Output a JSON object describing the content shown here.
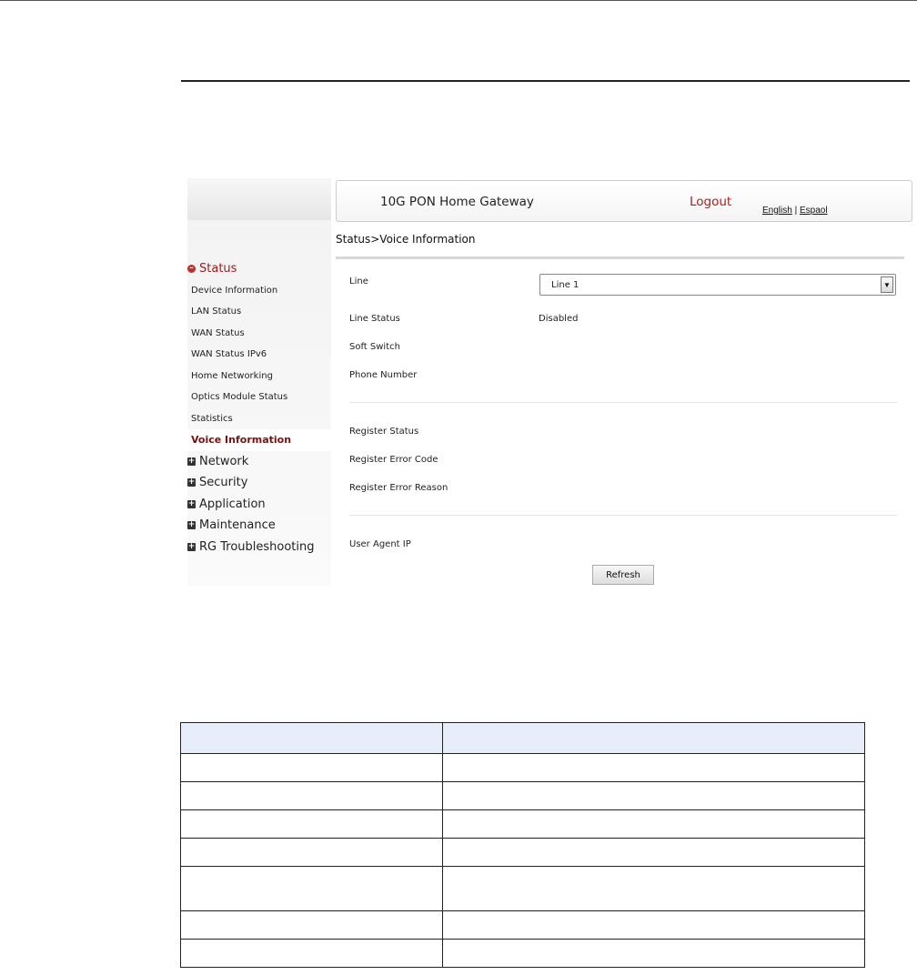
{
  "app": {
    "title": "10G PON Home Gateway",
    "logout": "Logout",
    "lang_english": "English",
    "lang_sep": "|",
    "lang_spanish": "Espaol"
  },
  "breadcrumb": "Status>Voice Information",
  "sidebar": {
    "status_label": "Status",
    "status_items": [
      "Device Information",
      "LAN Status",
      "WAN Status",
      "WAN Status IPv6",
      "Home Networking",
      "Optics Module Status",
      "Statistics",
      "Voice Information"
    ],
    "categories": [
      "Network",
      "Security",
      "Application",
      "Maintenance",
      "RG Troubleshooting"
    ]
  },
  "form": {
    "line_label": "Line",
    "line_selected": "Line 1",
    "line_status_label": "Line Status",
    "line_status_value": "Disabled",
    "soft_switch_label": "Soft Switch",
    "phone_number_label": "Phone Number",
    "register_status_label": "Register Status",
    "register_error_code_label": "Register Error Code",
    "register_error_reason_label": "Register Error Reason",
    "user_agent_ip_label": "User Agent IP",
    "refresh_label": "Refresh"
  },
  "colors": {
    "accent": "#a81f1f",
    "table_header": "#e6eefb"
  },
  "icons": {
    "expanded": "minus-circle-icon",
    "collapsed": "plus-box-icon",
    "select_arrow": "chevron-down-icon"
  }
}
